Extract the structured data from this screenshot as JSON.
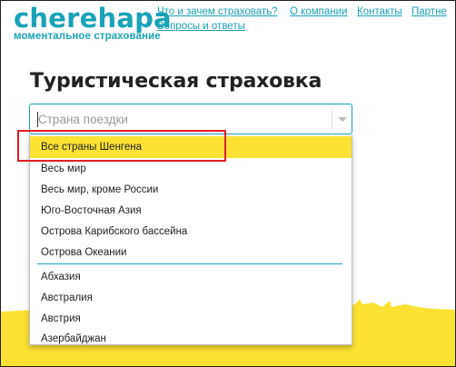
{
  "header": {
    "logo": "cherehapa",
    "tagline": "моментальное страхование",
    "nav": [
      "Что и зачем страховать?",
      "О компании",
      "Контакты",
      "Партне",
      "Вопросы и ответы"
    ]
  },
  "page_title": "Туристическая страховка",
  "country_select": {
    "placeholder": "Страна поездки",
    "value": ""
  },
  "dropdown": {
    "groups": [
      "Все страны Шенгена",
      "Весь мир",
      "Весь мир, кроме России",
      "Юго-Восточная Азия",
      "Острова Карибского бассейна",
      "Острова Океании"
    ],
    "countries": [
      "Абхазия",
      "Австралия",
      "Австрия",
      "Азербайджан"
    ],
    "highlighted": "Все страны Шенгена"
  },
  "colors": {
    "brand": "#1aa2b8",
    "highlight": "#fde234",
    "annotation": "#e01e24"
  }
}
